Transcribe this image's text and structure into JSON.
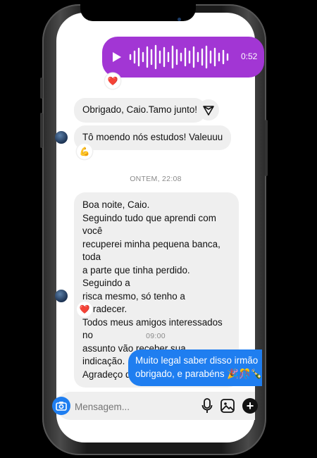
{
  "voice_message": {
    "duration": "0:52"
  },
  "reactions": {
    "voice": "❤️",
    "second": "💪",
    "long": "❤️"
  },
  "messages": {
    "m1": "Obrigado, Caio.Tamo junto!",
    "m2": "Tô moendo nós estudos! Valeuuu",
    "m3_lines": [
      "Boa noite, Caio.",
      "Seguindo tudo que aprendi com você",
      "recuperei minha pequena banca, toda",
      "a parte que tinha perdido. Seguindo a",
      "risca mesmo, só tenho a agradecer.",
      "Todos meus amigos interessados no",
      "assunto vão receber sua indicação.",
      "Agradeço demais demais!"
    ],
    "m4_lines": [
      "Muito legal saber disso irmão",
      "obrigado, e parabéns 🎉🎊🍾"
    ]
  },
  "timestamps": {
    "t1": "ONTEM, 22:08",
    "t2": "09:00"
  },
  "composer": {
    "placeholder": "Mensagem..."
  },
  "colors": {
    "voice_bubble": "#a236d4",
    "outgoing": "#1f7ef0",
    "incoming": "#efefef"
  },
  "icons": [
    "play-icon",
    "waveform-icon",
    "heart-icon",
    "share-icon",
    "flexed-biceps-icon",
    "camera-icon",
    "microphone-icon",
    "gallery-icon",
    "plus-icon"
  ]
}
